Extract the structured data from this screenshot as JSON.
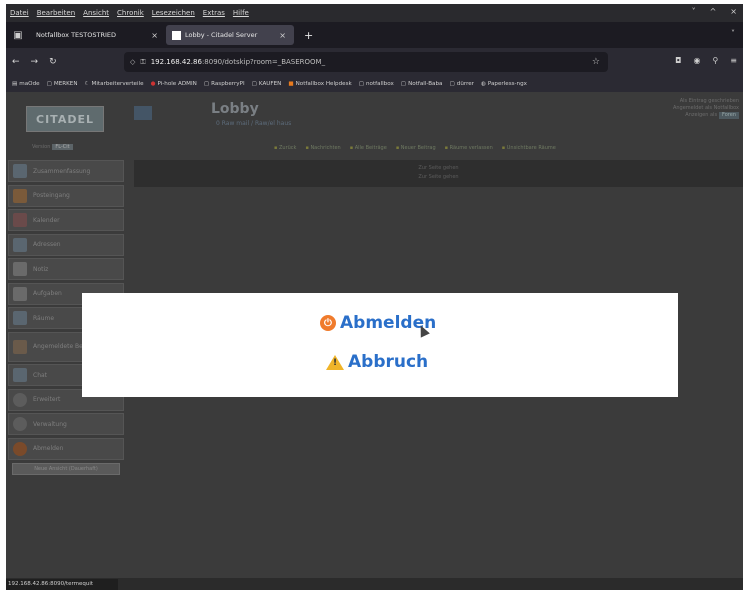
{
  "menubar": {
    "items": [
      "Datei",
      "Bearbeiten",
      "Ansicht",
      "Chronik",
      "Lesezeichen",
      "Extras",
      "Hilfe"
    ],
    "controls": [
      "˅",
      "^",
      "×"
    ]
  },
  "tabs": [
    {
      "label": "Notfallbox TESTOSTRIED",
      "active": false
    },
    {
      "label": "Lobby - Citadel Server",
      "active": true
    }
  ],
  "nav": {
    "url_host": "192.168.42.86",
    "url_rest": ":8090/dotskip?room=_BASEROOM_"
  },
  "bookmarks": [
    {
      "icon": "▤",
      "label": "maOde"
    },
    {
      "icon": "▢",
      "label": "MERKEN"
    },
    {
      "icon": "☾",
      "label": "Mitarbeiterverteile"
    },
    {
      "icon": "●",
      "label": "Pi-hole ADMIN"
    },
    {
      "icon": "▢",
      "label": "RaspberryPI"
    },
    {
      "icon": "▢",
      "label": "KAUFEN"
    },
    {
      "icon": "■",
      "label": "Notfallbox Helpdesk"
    },
    {
      "icon": "▢",
      "label": "notfallbox"
    },
    {
      "icon": "▢",
      "label": "Notfall-Baba"
    },
    {
      "icon": "▢",
      "label": "dürrer"
    },
    {
      "icon": "◍",
      "label": "Paperless-ngx"
    }
  ],
  "header": {
    "logo": "CITADEL",
    "room_title": "Lobby",
    "room_sub": "0 Raw mail / Raw/el haus",
    "info_line1": "Als Eintrag geschrieben",
    "info_line2": "Angemeldet als Notfallbox",
    "info_line3": "Anzeigen als",
    "info_select": "Foren"
  },
  "versionrow": {
    "label": "Version",
    "value": "FL-Cit"
  },
  "toolbar": [
    "Zurück",
    "Nachrichten",
    "Alle Beiträge",
    "Neuer Beitrag",
    "Räume verlassen",
    "Unsichtbare Räume"
  ],
  "sidebar": {
    "items": [
      "Zusammenfassung",
      "Posteingang",
      "Kalender",
      "Adressen",
      "Notiz",
      "Aufgaben",
      "Räume",
      "Angemeldete Benutzer",
      "Chat",
      "Erweitert",
      "Verwaltung",
      "Abmelden"
    ],
    "bottom_button": "Neue Ansicht (Dauerhaft)"
  },
  "content": {
    "line1": "Zur Seite gehen",
    "line2": "Zur Seite gehen"
  },
  "modal": {
    "logout_label": "Abmelden",
    "cancel_label": "Abbruch"
  },
  "statusbar": {
    "text": "192.168.42.86:8090/termequit"
  }
}
